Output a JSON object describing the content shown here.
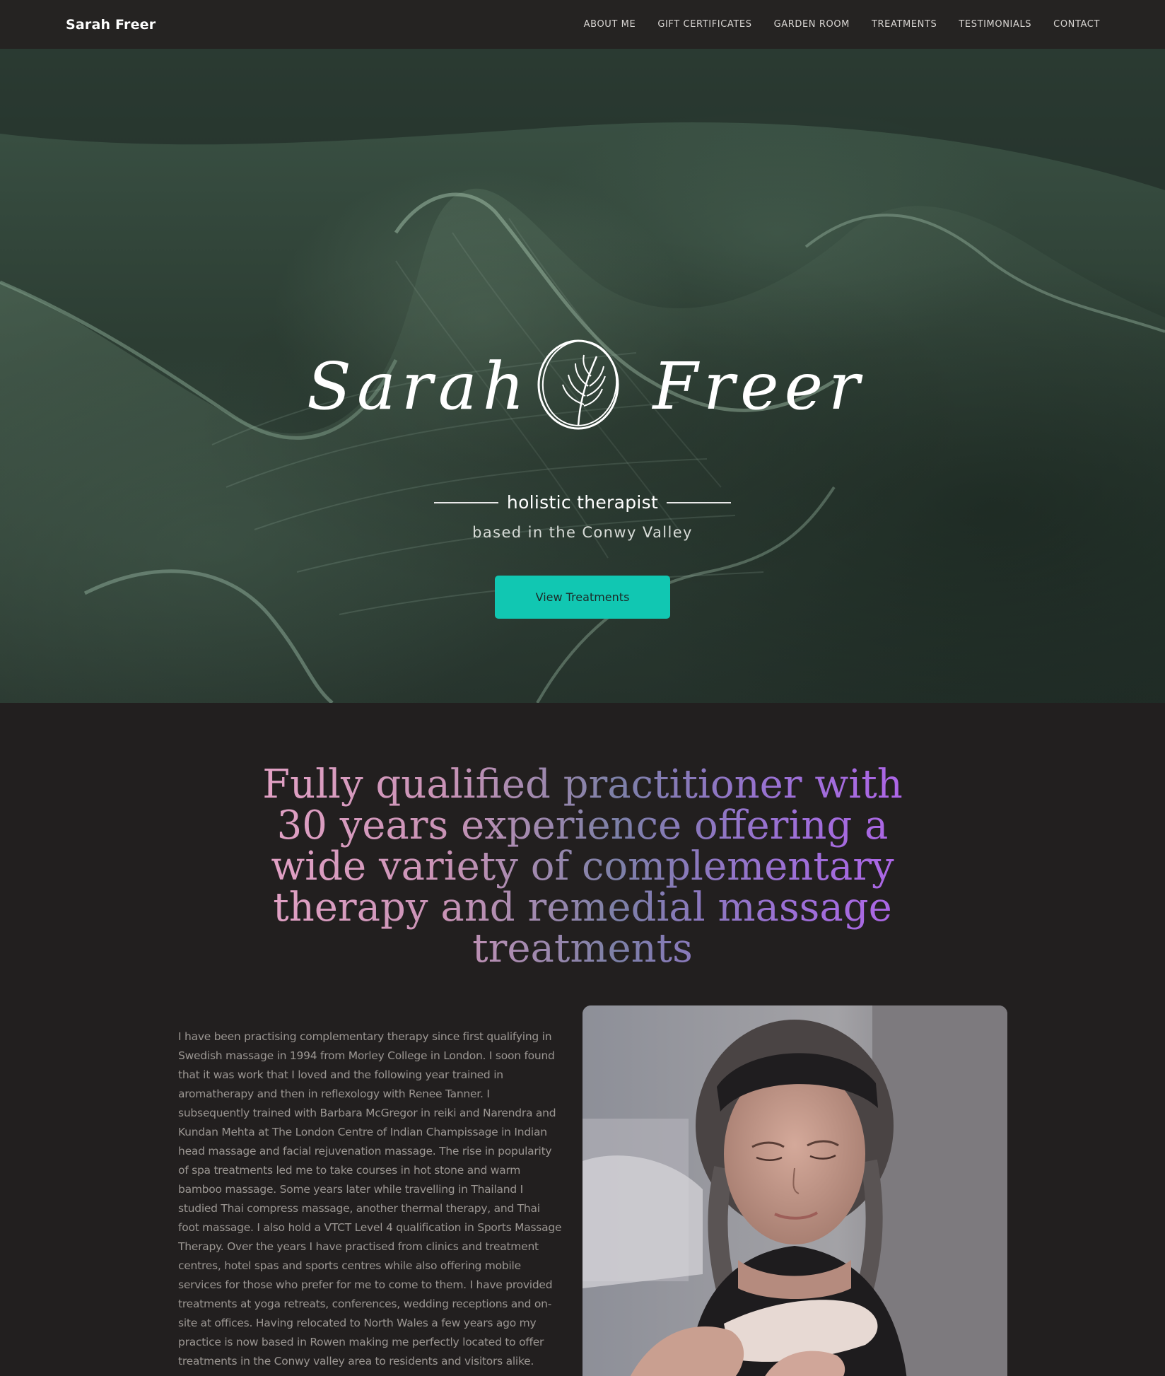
{
  "nav": {
    "brand": "Sarah Freer",
    "links": [
      {
        "label": "ABOUT ME"
      },
      {
        "label": "GIFT CERTIFICATES"
      },
      {
        "label": "GARDEN ROOM"
      },
      {
        "label": "TREATMENTS"
      },
      {
        "label": "TESTIMONIALS"
      },
      {
        "label": "CONTACT"
      }
    ]
  },
  "hero": {
    "logo_script_first": "Sarah",
    "logo_script_last": "Freer",
    "tagline": "holistic therapist",
    "subtagline": "based in the Conwy Valley",
    "cta_label": "View Treatments"
  },
  "intro": {
    "headline": "Fully qualified practitioner with 30 years experience offering a wide variety of complementary therapy and remedial massage treatments",
    "bio": "I have been practising complementary therapy since first qualifying in Swedish massage in 1994 from Morley College in London. I soon found that it was work that I loved and the following year trained in aromatherapy and then in reflexology with Renee Tanner. I subsequently trained with Barbara McGregor in reiki and Narendra and Kundan Mehta at The London Centre of Indian Champissage in Indian head massage and facial rejuvenation massage. The rise in popularity of spa treatments led me to take courses in hot stone and warm bamboo massage. Some years later while travelling in Thailand I studied Thai compress massage, another thermal therapy, and Thai foot massage. I also hold a VTCT Level 4 qualification in Sports Massage Therapy. Over the years I have practised from clinics and treatment centres, hotel spas and sports centres while also offering mobile services for those who prefer for me to come to them. I have provided treatments at yoga retreats, conferences, wedding receptions and on-site at offices. Having relocated to North Wales a few years ago my practice is now based in Rowen making me perfectly located to offer treatments in the Conwy valley area to residents and visitors alike."
  },
  "colors": {
    "nav_bg": "#252322",
    "page_bg": "#221f1f",
    "accent": "#11c7b2",
    "headline_gradient_start": "#e6a3c7",
    "headline_gradient_end": "#b163ea"
  }
}
